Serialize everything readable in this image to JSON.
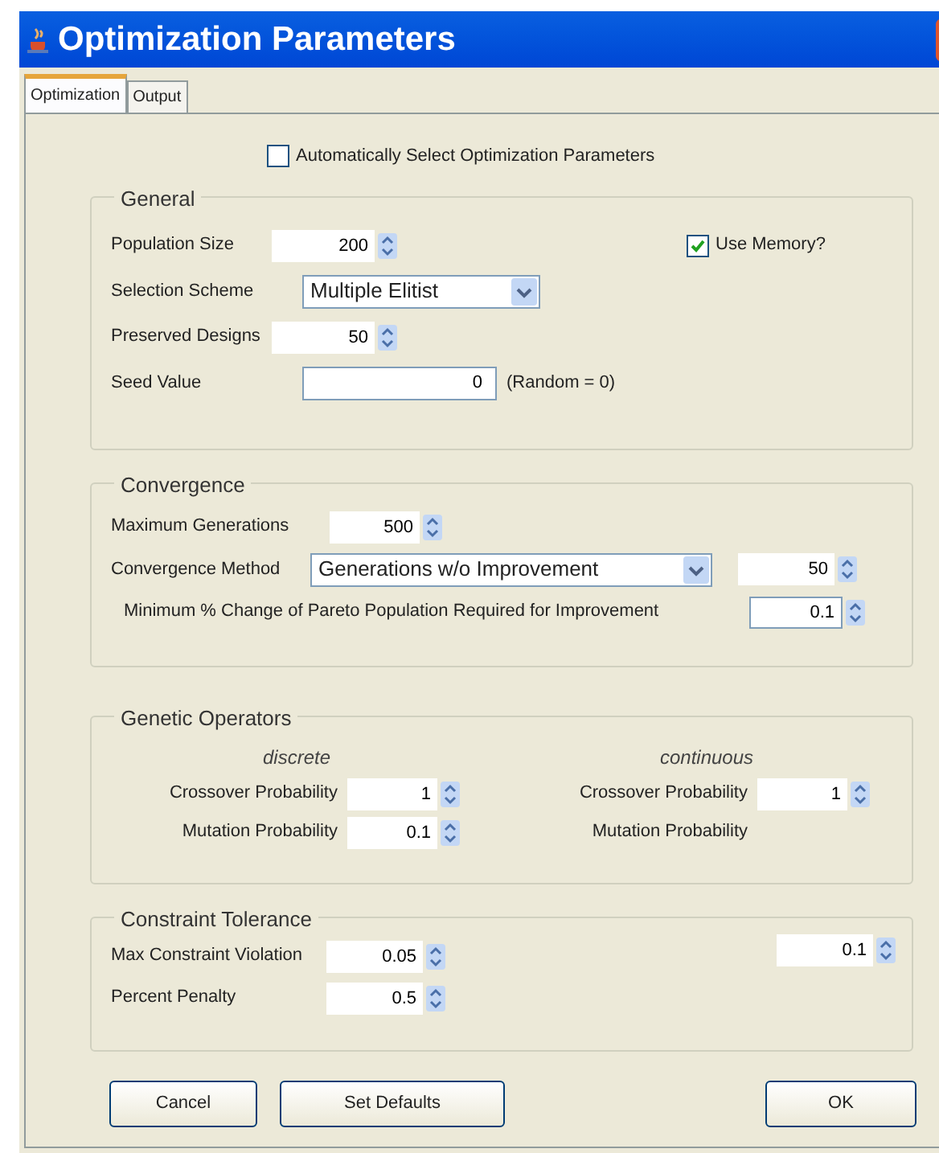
{
  "window": {
    "title": "Optimization Parameters"
  },
  "tabs": [
    {
      "label": "Optimization",
      "selected": true
    },
    {
      "label": "Output",
      "selected": false
    }
  ],
  "auto_select": {
    "label": "Automatically Select Optimization Parameters",
    "checked": false
  },
  "general": {
    "title": "General",
    "population_size": {
      "label": "Population Size",
      "value": "200"
    },
    "use_memory": {
      "label": "Use Memory?",
      "checked": true
    },
    "selection_scheme": {
      "label": "Selection Scheme",
      "value": "Multiple Elitist"
    },
    "preserved_designs": {
      "label": "Preserved Designs",
      "value": "50"
    },
    "seed_value": {
      "label": "Seed Value",
      "value": "0",
      "note": "(Random = 0)"
    }
  },
  "convergence": {
    "title": "Convergence",
    "max_generations": {
      "label": "Maximum Generations",
      "value": "500"
    },
    "method": {
      "label": "Convergence Method",
      "value": "Generations w/o Improvement",
      "count": "50"
    },
    "min_change": {
      "label": "Minimum % Change of Pareto Population Required for Improvement",
      "value": "0.1"
    }
  },
  "genetic_operators": {
    "title": "Genetic Operators",
    "discrete": {
      "heading": "discrete",
      "crossover": {
        "label": "Crossover Probability",
        "value": "1"
      },
      "mutation": {
        "label": "Mutation Probability",
        "value": "0.1"
      }
    },
    "continuous": {
      "heading": "continuous",
      "crossover": {
        "label": "Crossover Probability",
        "value": "1"
      },
      "mutation": {
        "label": "Mutation Probability"
      }
    }
  },
  "constraint_tolerance": {
    "title": "Constraint Tolerance",
    "max_violation": {
      "label": "Max Constraint Violation",
      "value": "0.05"
    },
    "percent_penalty": {
      "label": "Percent Penalty",
      "value": "0.5"
    },
    "extra_value": "0.1"
  },
  "buttons": [
    "Cancel",
    "Set Defaults",
    "OK"
  ]
}
